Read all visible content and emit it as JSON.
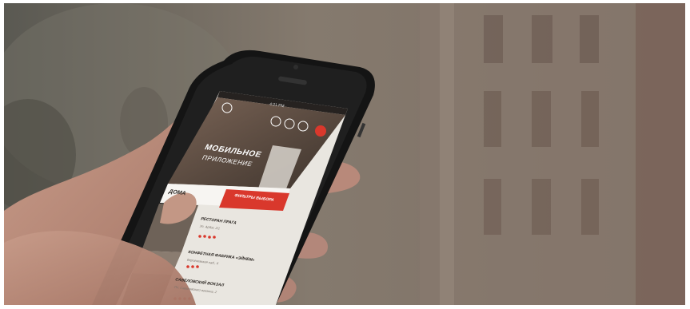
{
  "phone": {
    "status_time": "4:21 PM",
    "hero_title_line1": "МОБИЛЬНОЕ",
    "hero_title_line2": "ПРИЛОЖЕНИЕ",
    "section_label": "ДОМА",
    "filter_button_label": "ФИЛЬТРЫ ВЫБОРА",
    "list": [
      {
        "title": "РЕСТОРАН ПРАГА",
        "subtitle": "Ул. Арбат, 2/1",
        "rating": 4
      },
      {
        "title": "КОНФЕТНАЯ ФАБРИКА «ЭЙНЕМ»",
        "subtitle": "Берсеневская наб., 6",
        "rating": 3
      },
      {
        "title": "САВЕЛОВСКИЙ ВОКЗАЛ",
        "subtitle": "Пл. Савеловского вокзала, 2",
        "rating": 4
      }
    ]
  },
  "colors": {
    "accent": "#d9382c",
    "header_bg": "#4a3e36",
    "list_bg": "#f2f0ec"
  }
}
